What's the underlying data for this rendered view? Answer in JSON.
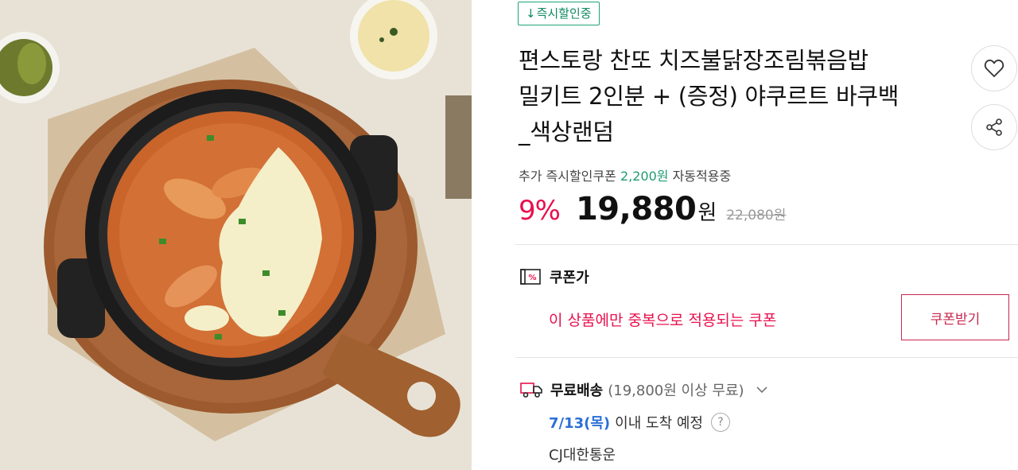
{
  "badge": {
    "arrow": "↓",
    "text": "즉시할인중"
  },
  "product": {
    "title_line1": "편스토랑 찬또 치즈불닭장조림볶음밥",
    "title_line2": "밀키트 2인분 + (증정) 야쿠르트 바쿠백",
    "title_line3": "_색상랜덤"
  },
  "actions": {
    "wish_icon": "heart-icon",
    "share_icon": "share-icon"
  },
  "coupon_note": {
    "prefix": "추가 즉시할인쿠폰",
    "amount": "2,200원",
    "suffix": "자동적용중"
  },
  "price": {
    "discount": "9%",
    "value": "19,880",
    "unit": "원",
    "original": "22,080원"
  },
  "coupon": {
    "label": "쿠폰가",
    "description": "이 상품에만 중복으로 적용되는 쿠폰",
    "button": "쿠폰받기"
  },
  "shipping": {
    "label": "무료배송",
    "condition": "(19,800원 이상 무료)",
    "arrival_date": "7/13(목)",
    "arrival_text": "이내 도착 예정",
    "help": "?",
    "carrier": "CJ대한통운"
  },
  "colors": {
    "accent_red": "#e8114d",
    "green": "#1f9c6e",
    "blue": "#2b6fd6"
  }
}
